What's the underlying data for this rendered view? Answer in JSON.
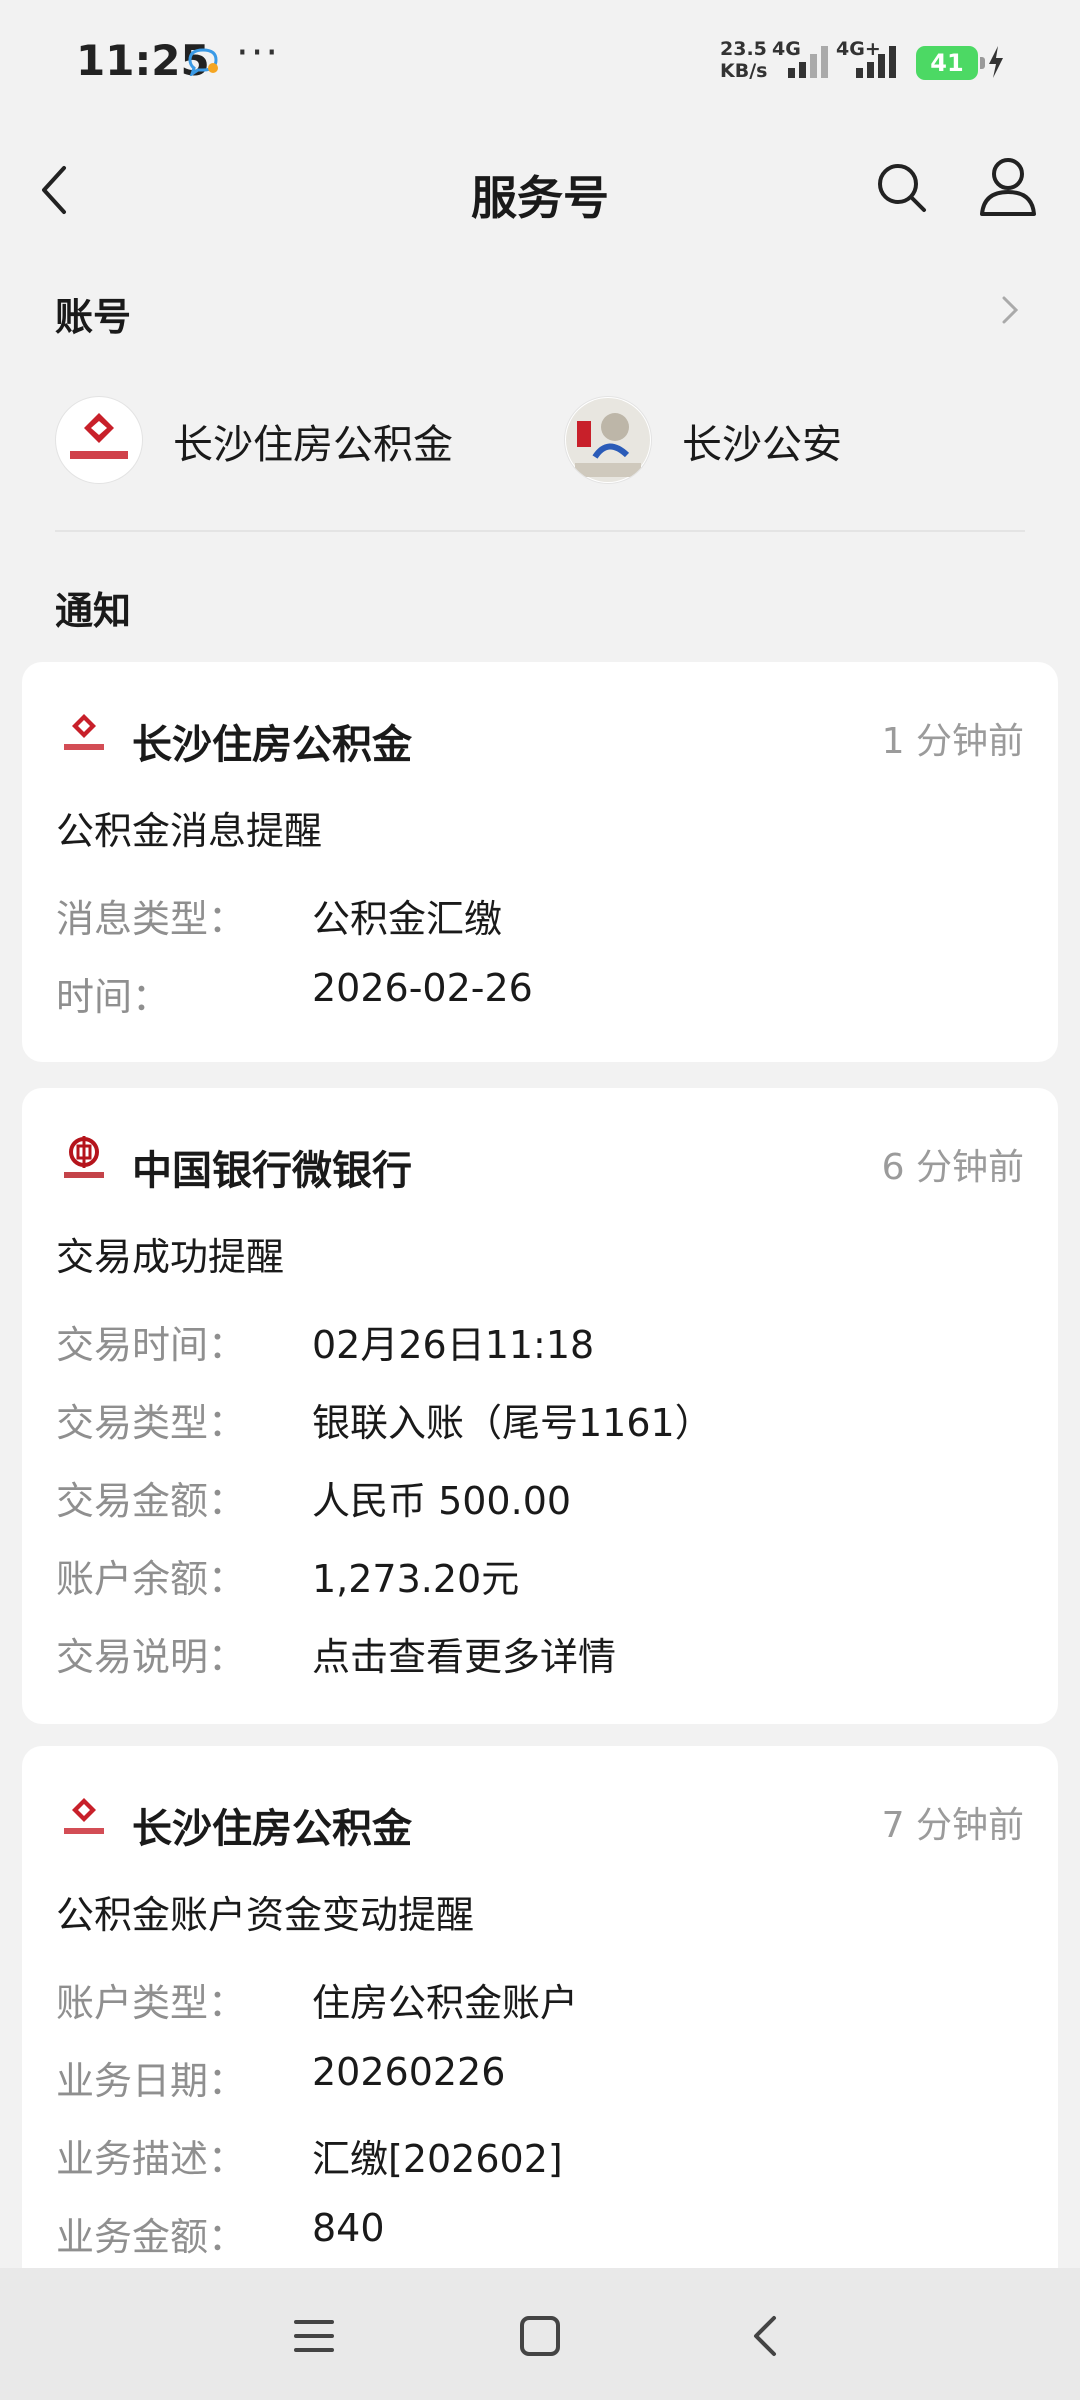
{
  "status": {
    "time": "11:25",
    "net_speed_value": "23.5",
    "net_speed_unit": "KB/s",
    "network_1": "4G",
    "network_2": "4G+",
    "battery": "41"
  },
  "header": {
    "title": "服务号"
  },
  "accounts": {
    "heading": "账号",
    "items": [
      {
        "name": "长沙住房公积金",
        "icon": "housing-fund-logo-icon"
      },
      {
        "name": "长沙公安",
        "icon": "police-logo-icon"
      }
    ]
  },
  "notices": {
    "heading": "通知",
    "cards": [
      {
        "sender": "长沙住房公积金",
        "time": "1 分钟前",
        "title": "公积金消息提醒",
        "fields": [
          {
            "label": "消息类型：",
            "value": "公积金汇缴"
          },
          {
            "label": "时间：",
            "value": "2026-02-26"
          }
        ]
      },
      {
        "sender": "中国银行微银行",
        "time": "6 分钟前",
        "title": "交易成功提醒",
        "fields": [
          {
            "label": "交易时间：",
            "value": "02月26日11:18"
          },
          {
            "label": "交易类型：",
            "value": "银联入账（尾号1161）"
          },
          {
            "label": "交易金额：",
            "value": "人民币 500.00"
          },
          {
            "label": "账户余额：",
            "value": "1,273.20元"
          },
          {
            "label": "交易说明：",
            "value": "点击查看更多详情"
          }
        ]
      },
      {
        "sender": "长沙住房公积金",
        "time": "7 分钟前",
        "title": "公积金账户资金变动提醒",
        "fields": [
          {
            "label": "账户类型：",
            "value": "住房公积金账户"
          },
          {
            "label": "业务日期：",
            "value": "20260226"
          },
          {
            "label": "业务描述：",
            "value": "汇缴[202602]"
          },
          {
            "label": "业务金额：",
            "value": "840"
          }
        ]
      }
    ]
  },
  "colors": {
    "battery": "#4cd964",
    "background": "#f2f2f2",
    "card": "#ffffff",
    "muted": "#8f8f8f"
  }
}
